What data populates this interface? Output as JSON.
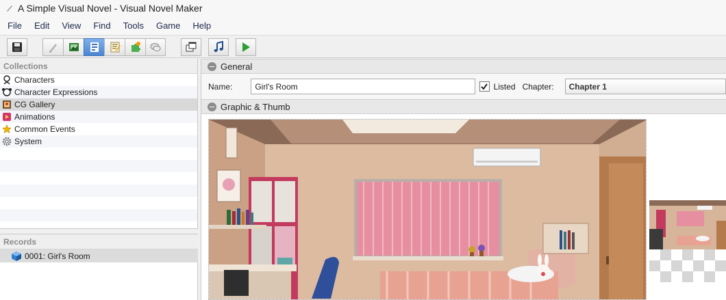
{
  "window": {
    "title": "A Simple Visual Novel - Visual Novel Maker"
  },
  "menu": [
    "File",
    "Edit",
    "View",
    "Find",
    "Tools",
    "Game",
    "Help"
  ],
  "toolbar": {
    "buttons": [
      "save-icon",
      "pencil-icon",
      "image-icon",
      "database-icon",
      "script-icon",
      "puzzle-icon",
      "speech-bubble-icon",
      "windows-icon",
      "music-icon",
      "play-icon"
    ],
    "active": "database-icon",
    "accent": "#4a86d4"
  },
  "collections": {
    "header": "Collections",
    "items": [
      {
        "label": "Characters",
        "icon": "character-icon"
      },
      {
        "label": "Character Expressions",
        "icon": "expression-icon"
      },
      {
        "label": "CG Gallery",
        "icon": "gallery-icon",
        "selected": true
      },
      {
        "label": "Animations",
        "icon": "animation-icon"
      },
      {
        "label": "Common Events",
        "icon": "star-icon"
      },
      {
        "label": "System",
        "icon": "gear-icon"
      }
    ]
  },
  "records": {
    "header": "Records",
    "items": [
      {
        "label": "0001: Girl's Room",
        "icon": "cube-icon"
      }
    ]
  },
  "general": {
    "header": "General",
    "name_label": "Name:",
    "name_value": "Girl's Room",
    "listed_label": "Listed",
    "listed_checked": true,
    "chapter_label": "Chapter:",
    "chapter_value": "Chapter 1"
  },
  "graphic": {
    "header": "Graphic & Thumb"
  }
}
